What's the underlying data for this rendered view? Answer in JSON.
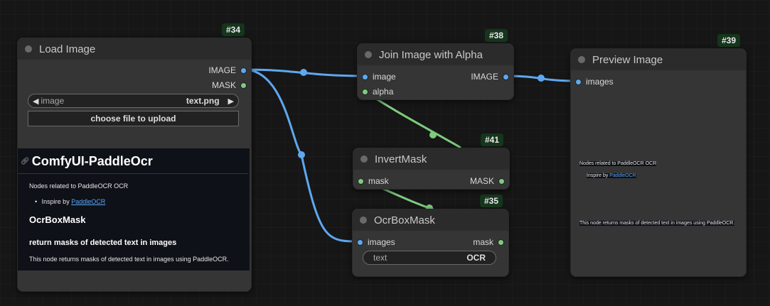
{
  "nodes": {
    "load_image": {
      "id": "#34",
      "title": "Load Image",
      "outputs": [
        "IMAGE",
        "MASK"
      ],
      "widget_name": "image",
      "widget_value": "text.png",
      "upload_button": "choose file to upload",
      "doc": {
        "title": "ComfyUI-PaddleOcr",
        "intro": "Nodes related to PaddleOCR OCR",
        "bullet_prefix": "Inspire by ",
        "bullet_link": "PaddleOCR",
        "node_heading": "OcrBoxMask",
        "subheading": "return masks of detected text in images",
        "body": "This node returns masks of detected text in images using PaddleOCR."
      }
    },
    "join_alpha": {
      "id": "#38",
      "title": "Join Image with Alpha",
      "inputs": [
        "image",
        "alpha"
      ],
      "output": "IMAGE"
    },
    "invert_mask": {
      "id": "#41",
      "title": "InvertMask",
      "input": "mask",
      "output": "MASK"
    },
    "ocr_box_mask": {
      "id": "#35",
      "title": "OcrBoxMask",
      "input": "images",
      "output": "mask",
      "widget_name": "text",
      "widget_value": "OCR"
    },
    "preview_image": {
      "id": "#39",
      "title": "Preview Image",
      "input": "images",
      "doc_intro": "Nodes related to PaddleOCR OCR",
      "doc_bullet_prefix": "Inspire by ",
      "doc_bullet_link": "PaddleOCR",
      "doc_body": "This node returns masks of detected text in images using PaddleOCR."
    }
  },
  "colors": {
    "image_link": "#5ea8f0",
    "mask_link": "#7ecb7e",
    "badge_bg": "#15351c"
  }
}
